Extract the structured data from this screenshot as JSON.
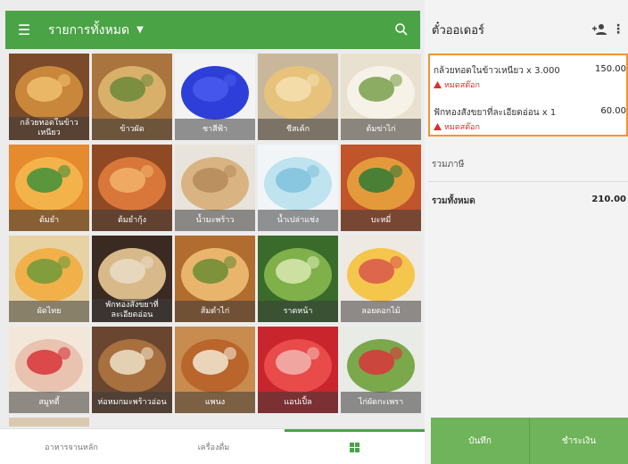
{
  "app": {
    "category_title": "รายการทั้งหมด",
    "order_title": "ตั๋วออเดอร์"
  },
  "colors": {
    "primary_green": "#4aa345",
    "action_green": "#6fb35a",
    "highlight_orange": "#f39332",
    "warning_red": "#d9302c"
  },
  "icons": {
    "menu": "hamburger-icon",
    "dropdown": "caret-down-icon",
    "search": "search-icon",
    "add_customer": "add-person-icon",
    "more": "more-vertical-icon",
    "warning": "warning-triangle-icon",
    "grid_tab": "grid-icon"
  },
  "products": [
    {
      "name": "กล้วยทอดในข้าวเหนียว"
    },
    {
      "name": "ข้าวผัด"
    },
    {
      "name": "ชาสีฟ้า"
    },
    {
      "name": "ชีสเค้ก"
    },
    {
      "name": "ต้มข่าไก่"
    },
    {
      "name": "ต้มยำ"
    },
    {
      "name": "ต้มยำกุ้ง"
    },
    {
      "name": "น้ำมะพร้าว"
    },
    {
      "name": "น้ำเปล่าแช่ง"
    },
    {
      "name": "บะหมี่"
    },
    {
      "name": "ผัดไทย"
    },
    {
      "name": "พักทองสังขยาที่ละเอียดอ่อน"
    },
    {
      "name": "ส้มตำไก่"
    },
    {
      "name": "ราดหน้า"
    },
    {
      "name": "ลอยดอกไม้"
    },
    {
      "name": "สมูทตี้"
    },
    {
      "name": "ห่อหมกมะพร้าวอ่อน"
    },
    {
      "name": "แพนง"
    },
    {
      "name": "แอปเปิ้ล"
    },
    {
      "name": "ไก่ผัดกะเพรา"
    }
  ],
  "bottom_tabs": [
    {
      "label": "อาหารจานหลัก"
    },
    {
      "label": "เครื่องดื่ม"
    }
  ],
  "order": {
    "items": [
      {
        "name": "กล้วยทอดในข้าวเหนียว x 3.000",
        "price": "150.00",
        "warning": "หมดสต๊อก"
      },
      {
        "name": "ฟักทองสังขยาที่ละเอียดอ่อน x 1",
        "price": "60.00",
        "warning": "หมดสต๊อก"
      }
    ],
    "tax_label": "รวมภาษี",
    "total_label": "รวมทั้งหมด",
    "total_value": "210.00"
  },
  "actions": {
    "save": "บันทึก",
    "pay": "ชำระเงิน"
  }
}
